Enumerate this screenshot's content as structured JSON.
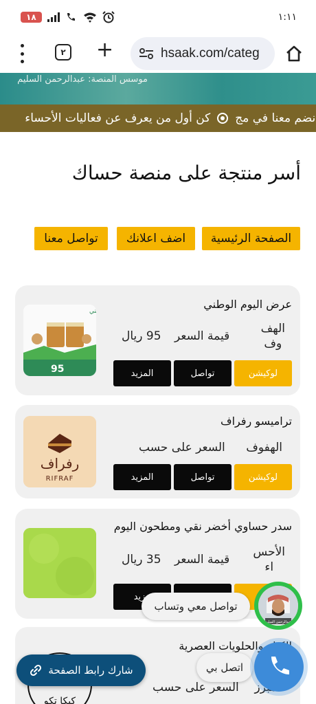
{
  "status_bar": {
    "battery": "١٨",
    "time": "١:١١"
  },
  "browser": {
    "tab_count": "٢",
    "url": "hsaak.com/categ"
  },
  "banner": {
    "founder_text": "موسس المنصة: عبدالرحمن السليم"
  },
  "ticker": {
    "text_1": "إنضم معنا في مج",
    "text_2": "كن أول من يعرف عن فعاليات الأحساء"
  },
  "page_title": "أسر منتجة على منصة حساك",
  "nav": {
    "home": "الصفحة الرئيسية",
    "add_ad": "اضف اعلانك",
    "contact": "تواصل معنا"
  },
  "cards": [
    {
      "title": "عرض اليوم الوطني",
      "city_line1": "الهف",
      "city_line2": "وف",
      "price_label": "قيمة السعر",
      "price_value": "95 ريال",
      "location_btn": "لوكيشن",
      "contact_btn": "تواصل",
      "more_btn": "المزيد",
      "image_caption": "عرض اليوم الوطني",
      "image_price": "95"
    },
    {
      "title": "تراميسو رفراف",
      "city": "الهفوف",
      "price_label": "السعر على حسب",
      "location_btn": "لوكيشن",
      "contact_btn": "تواصل",
      "more_btn": "المزيد",
      "logo_ar": "رفراف",
      "logo_en": "RIFRAF"
    },
    {
      "title": "سدر حساوي أخضر نقي ومطحون اليوم",
      "city_line1": "الأحس",
      "city_line2": "اء",
      "price_label": "قيمة السعر",
      "price_value": "35 ريال",
      "more_btn": "مزيد"
    },
    {
      "title_line1": "الكيك والحلويات العصرية",
      "city": "المبرز",
      "price_label": "السعر على حسب",
      "logo_text": "كيكا تكو"
    }
  ],
  "floating": {
    "whatsapp_label": "تواصل معي وتساب",
    "call_label": "اتصل بي",
    "share_label": "شارك رابط الصفحة",
    "avatar_caption": "عبدالرحمن السليم"
  },
  "colors": {
    "accent_yellow": "#f5b400",
    "banner_teal": "#2b8c8a",
    "ticker_brown": "#7a6528",
    "share_blue": "#0d4f7a",
    "call_blue": "#3d8bd9",
    "whatsapp_green": "#2fbf4a"
  }
}
